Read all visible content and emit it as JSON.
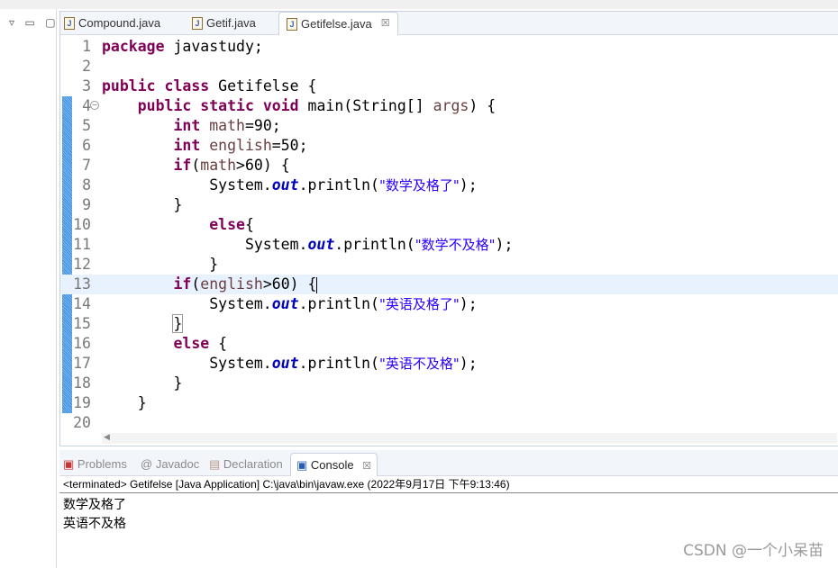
{
  "editor": {
    "tabs": [
      {
        "label": "Compound.java",
        "active": false,
        "warning": true
      },
      {
        "label": "Getif.java",
        "active": false
      },
      {
        "label": "Getifelse.java",
        "active": true,
        "close": "☒"
      }
    ],
    "current_line": 13,
    "lines": [
      [
        [
          "package",
          "kw"
        ],
        [
          " javastudy;",
          "pl"
        ]
      ],
      [],
      [
        [
          "public",
          "kw"
        ],
        [
          " ",
          "pl"
        ],
        [
          "class",
          "kw"
        ],
        [
          " Getifelse {",
          "pl"
        ]
      ],
      [
        [
          "    ",
          "pl"
        ],
        [
          "public",
          "kw"
        ],
        [
          " ",
          "pl"
        ],
        [
          "static",
          "kw"
        ],
        [
          " ",
          "pl"
        ],
        [
          "void",
          "kw"
        ],
        [
          " main(String[] ",
          "pl"
        ],
        [
          "args",
          "var"
        ],
        [
          ") {",
          "pl"
        ]
      ],
      [
        [
          "        ",
          "pl"
        ],
        [
          "int",
          "kw"
        ],
        [
          " ",
          "pl"
        ],
        [
          "math",
          "var"
        ],
        [
          "=90;",
          "pl"
        ]
      ],
      [
        [
          "        ",
          "pl"
        ],
        [
          "int",
          "kw"
        ],
        [
          " ",
          "pl"
        ],
        [
          "english",
          "var"
        ],
        [
          "=50;",
          "pl"
        ]
      ],
      [
        [
          "        ",
          "pl"
        ],
        [
          "if",
          "kw"
        ],
        [
          "(",
          "pl"
        ],
        [
          "math",
          "var"
        ],
        [
          ">60) {",
          "pl"
        ]
      ],
      [
        [
          "            System.",
          "pl"
        ],
        [
          "out",
          "fld"
        ],
        [
          ".println(",
          "pl"
        ],
        [
          "\"数学及格了\"",
          "str"
        ],
        [
          ");",
          "pl"
        ]
      ],
      [
        [
          "        }",
          "pl"
        ]
      ],
      [
        [
          "            ",
          "pl"
        ],
        [
          "else",
          "kw"
        ],
        [
          "{",
          "pl"
        ]
      ],
      [
        [
          "                System.",
          "pl"
        ],
        [
          "out",
          "fld"
        ],
        [
          ".println(",
          "pl"
        ],
        [
          "\"数学不及格\"",
          "str"
        ],
        [
          ");",
          "pl"
        ]
      ],
      [
        [
          "            }",
          "pl"
        ]
      ],
      [
        [
          "        ",
          "pl"
        ],
        [
          "if",
          "kw"
        ],
        [
          "(",
          "pl"
        ],
        [
          "english",
          "var"
        ],
        [
          ">60) {",
          "pl"
        ]
      ],
      [
        [
          "            System.",
          "pl"
        ],
        [
          "out",
          "fld"
        ],
        [
          ".println(",
          "pl"
        ],
        [
          "\"英语及格了\"",
          "str"
        ],
        [
          ");",
          "pl"
        ]
      ],
      [
        [
          "        ",
          "pl"
        ],
        [
          "}",
          "pl"
        ]
      ],
      [
        [
          "        ",
          "pl"
        ],
        [
          "else",
          "kw"
        ],
        [
          " {",
          "pl"
        ]
      ],
      [
        [
          "            System.",
          "pl"
        ],
        [
          "out",
          "fld"
        ],
        [
          ".println(",
          "pl"
        ],
        [
          "\"英语不及格\"",
          "str"
        ],
        [
          ");",
          "pl"
        ]
      ],
      [
        [
          "        }",
          "pl"
        ]
      ],
      [
        [
          "    }",
          "pl"
        ]
      ],
      []
    ]
  },
  "bottom": {
    "tabs": [
      {
        "label": "Problems",
        "icon": "problems-icon"
      },
      {
        "label": "Javadoc",
        "icon": "at-icon"
      },
      {
        "label": "Declaration",
        "icon": "declaration-icon"
      },
      {
        "label": "Console",
        "icon": "console-icon",
        "active": true
      }
    ],
    "close": "☒",
    "console_header": "<terminated> Getifelse [Java Application] C:\\java\\bin\\javaw.exe (2022年9月17日 下午9:13:46)",
    "output": [
      "数学及格了",
      "英语不及格"
    ]
  },
  "watermark": "CSDN @一个小呆苗"
}
